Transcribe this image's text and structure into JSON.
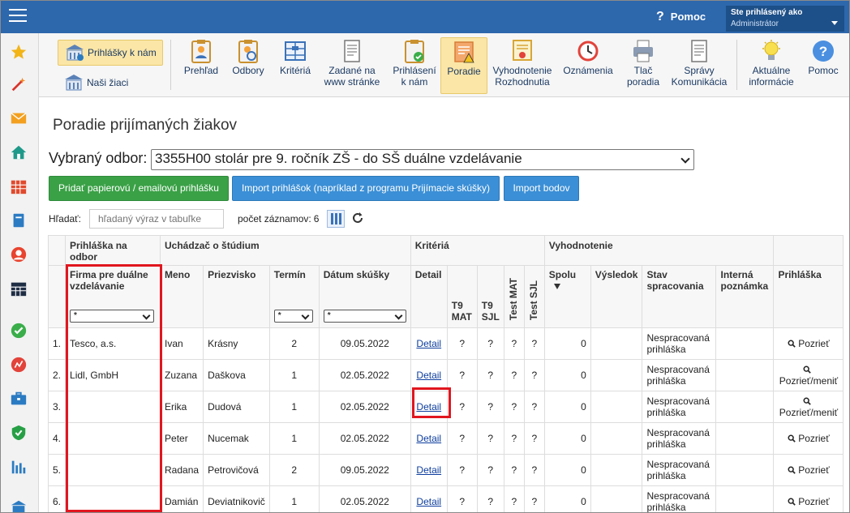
{
  "topbar": {
    "help_label": "Pomoc",
    "user_line1": "Ste prihlásený ako",
    "user_line2": "Administrátor"
  },
  "sidebar": {
    "icons": [
      "star-icon",
      "magic-wand-icon",
      "envelope-icon",
      "home-icon",
      "calendar-grid-icon",
      "book-icon",
      "user-circle-icon",
      "schedule-icon",
      "check-circle-icon",
      "chart-circle-icon",
      "briefcase-icon",
      "shield-check-icon",
      "bar-chart-icon"
    ]
  },
  "toolbar": {
    "prihlasky_label": "Prihlášky k nám",
    "ziaci_label": "Naši žiaci",
    "buttons": [
      {
        "line1": "Prehľad",
        "line2": "",
        "icon": "clipboard-eye-icon"
      },
      {
        "line1": "Odbory",
        "line2": "",
        "icon": "clipboard-search-icon"
      },
      {
        "line1": "Kritériá",
        "line2": "",
        "icon": "sliders-icon"
      },
      {
        "line1": "Zadané na",
        "line2": "www stránke",
        "icon": "document-icon"
      },
      {
        "line1": "Prihlásení",
        "line2": "k nám",
        "icon": "clipboard-check-icon"
      },
      {
        "line1": "Poradie",
        "line2": "",
        "icon": "ranking-warning-icon"
      },
      {
        "line1": "Vyhodnotenie",
        "line2": "Rozhodnutia",
        "icon": "certificate-icon"
      },
      {
        "line1": "Oznámenia",
        "line2": "",
        "icon": "clock-alarm-icon"
      },
      {
        "line1": "Tlač",
        "line2": "poradia",
        "icon": "printer-icon"
      },
      {
        "line1": "Správy",
        "line2": "Komunikácia",
        "icon": "message-document-icon"
      },
      {
        "line1": "Aktuálne",
        "line2": "informácie",
        "icon": "lightbulb-icon"
      },
      {
        "line1": "Pomoc",
        "line2": "",
        "icon": "help-circle-icon"
      }
    ]
  },
  "page": {
    "title": "Poradie prijímaných žiakov",
    "odbor_label": "Vybraný odbor:",
    "odbor_value": "3355H00 stolár pre 9. ročník ZŠ - do SŠ duálne vzdelávanie",
    "add_button": "Pridať papierovú / emailovú prihlášku",
    "import_button": "Import prihlášok (napríklad z programu Prijímacie skúšky)",
    "points_button": "Import bodov",
    "search_label": "Hľadať:",
    "search_placeholder": "hľadaný výraz v tabuľke",
    "count_label": "počet záznamov:",
    "count_value": "6"
  },
  "table": {
    "groups": {
      "prihlaska": "Prihláška na odbor",
      "uchadzac": "Uchádzač o štúdium",
      "kriteria": "Kritériá",
      "vyhodnotenie": "Vyhodnotenie"
    },
    "headers": {
      "firma": "Firma pre duálne vzdelávanie",
      "meno": "Meno",
      "priezvisko": "Priezvisko",
      "termin": "Termín",
      "datum": "Dátum skúšky",
      "detail": "Detail",
      "t9mat": "T9 MAT",
      "t9sjl": "T9 SJL",
      "testmat": "Test MAT",
      "testsjl": "Test SJL",
      "spolu": "Spolu",
      "vysledok": "Výsledok",
      "stav": "Stav spracovania",
      "interna": "Interná poznámka",
      "prihlaska": "Prihláška"
    },
    "filters": {
      "firma": "*",
      "termin": "*",
      "datum": "*"
    },
    "rows": [
      {
        "num": "1.",
        "firma": "Tesco, a.s.",
        "meno": "Ivan",
        "priezvisko": "Krásny",
        "termin": "2",
        "datum": "09.05.2022",
        "detail": "Detail",
        "t9mat": "?",
        "t9sjl": "?",
        "testmat": "?",
        "testsjl": "?",
        "spolu": "0",
        "stav": "Nespracovaná prihláška",
        "action": "Pozrieť"
      },
      {
        "num": "2.",
        "firma": "Lidl, GmbH",
        "meno": "Zuzana",
        "priezvisko": "Daškova",
        "termin": "1",
        "datum": "02.05.2022",
        "detail": "Detail",
        "t9mat": "?",
        "t9sjl": "?",
        "testmat": "?",
        "testsjl": "?",
        "spolu": "0",
        "stav": "Nespracovaná prihláška",
        "action": "Pozrieť/meniť"
      },
      {
        "num": "3.",
        "firma": "",
        "meno": "Erika",
        "priezvisko": "Dudová",
        "termin": "1",
        "datum": "02.05.2022",
        "detail": "Detail",
        "t9mat": "?",
        "t9sjl": "?",
        "testmat": "?",
        "testsjl": "?",
        "spolu": "0",
        "stav": "Nespracovaná prihláška",
        "action": "Pozrieť/meniť"
      },
      {
        "num": "4.",
        "firma": "",
        "meno": "Peter",
        "priezvisko": "Nucemak",
        "termin": "1",
        "datum": "02.05.2022",
        "detail": "Detail",
        "t9mat": "?",
        "t9sjl": "?",
        "testmat": "?",
        "testsjl": "?",
        "spolu": "0",
        "stav": "Nespracovaná prihláška",
        "action": "Pozrieť"
      },
      {
        "num": "5.",
        "firma": "",
        "meno": "Radana",
        "priezvisko": "Petrovičová",
        "termin": "2",
        "datum": "09.05.2022",
        "detail": "Detail",
        "t9mat": "?",
        "t9sjl": "?",
        "testmat": "?",
        "testsjl": "?",
        "spolu": "0",
        "stav": "Nespracovaná prihláška",
        "action": "Pozrieť"
      },
      {
        "num": "6.",
        "firma": "",
        "meno": "Damián",
        "priezvisko": "Deviatnikovič",
        "termin": "1",
        "datum": "02.05.2022",
        "detail": "Detail",
        "t9mat": "?",
        "t9sjl": "?",
        "testmat": "?",
        "testsjl": "?",
        "spolu": "0",
        "stav": "Nespracovaná prihláška",
        "action": "Pozrieť"
      }
    ]
  }
}
